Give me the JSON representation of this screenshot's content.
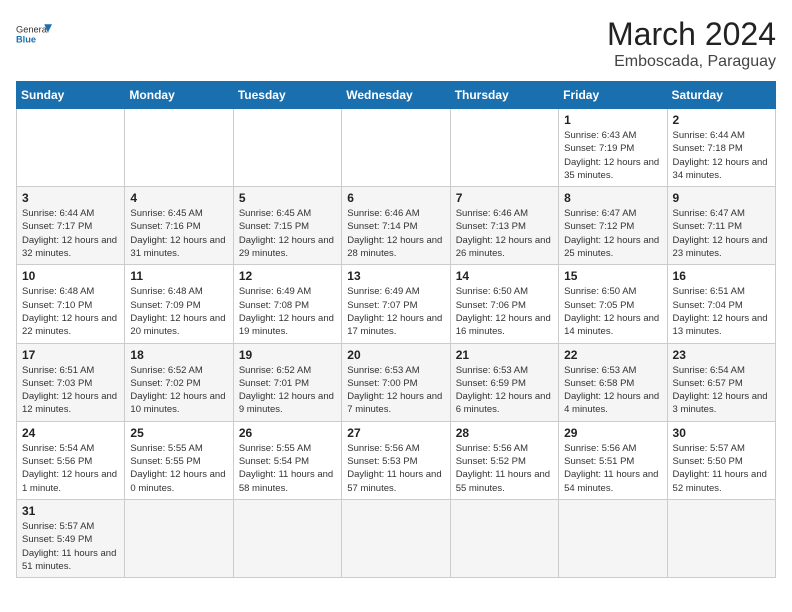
{
  "header": {
    "title": "March 2024",
    "subtitle": "Emboscada, Paraguay",
    "logo_general": "General",
    "logo_blue": "Blue"
  },
  "weekdays": [
    "Sunday",
    "Monday",
    "Tuesday",
    "Wednesday",
    "Thursday",
    "Friday",
    "Saturday"
  ],
  "weeks": [
    [
      {
        "day": "",
        "info": ""
      },
      {
        "day": "",
        "info": ""
      },
      {
        "day": "",
        "info": ""
      },
      {
        "day": "",
        "info": ""
      },
      {
        "day": "",
        "info": ""
      },
      {
        "day": "1",
        "info": "Sunrise: 6:43 AM\nSunset: 7:19 PM\nDaylight: 12 hours and 35 minutes."
      },
      {
        "day": "2",
        "info": "Sunrise: 6:44 AM\nSunset: 7:18 PM\nDaylight: 12 hours and 34 minutes."
      }
    ],
    [
      {
        "day": "3",
        "info": "Sunrise: 6:44 AM\nSunset: 7:17 PM\nDaylight: 12 hours and 32 minutes."
      },
      {
        "day": "4",
        "info": "Sunrise: 6:45 AM\nSunset: 7:16 PM\nDaylight: 12 hours and 31 minutes."
      },
      {
        "day": "5",
        "info": "Sunrise: 6:45 AM\nSunset: 7:15 PM\nDaylight: 12 hours and 29 minutes."
      },
      {
        "day": "6",
        "info": "Sunrise: 6:46 AM\nSunset: 7:14 PM\nDaylight: 12 hours and 28 minutes."
      },
      {
        "day": "7",
        "info": "Sunrise: 6:46 AM\nSunset: 7:13 PM\nDaylight: 12 hours and 26 minutes."
      },
      {
        "day": "8",
        "info": "Sunrise: 6:47 AM\nSunset: 7:12 PM\nDaylight: 12 hours and 25 minutes."
      },
      {
        "day": "9",
        "info": "Sunrise: 6:47 AM\nSunset: 7:11 PM\nDaylight: 12 hours and 23 minutes."
      }
    ],
    [
      {
        "day": "10",
        "info": "Sunrise: 6:48 AM\nSunset: 7:10 PM\nDaylight: 12 hours and 22 minutes."
      },
      {
        "day": "11",
        "info": "Sunrise: 6:48 AM\nSunset: 7:09 PM\nDaylight: 12 hours and 20 minutes."
      },
      {
        "day": "12",
        "info": "Sunrise: 6:49 AM\nSunset: 7:08 PM\nDaylight: 12 hours and 19 minutes."
      },
      {
        "day": "13",
        "info": "Sunrise: 6:49 AM\nSunset: 7:07 PM\nDaylight: 12 hours and 17 minutes."
      },
      {
        "day": "14",
        "info": "Sunrise: 6:50 AM\nSunset: 7:06 PM\nDaylight: 12 hours and 16 minutes."
      },
      {
        "day": "15",
        "info": "Sunrise: 6:50 AM\nSunset: 7:05 PM\nDaylight: 12 hours and 14 minutes."
      },
      {
        "day": "16",
        "info": "Sunrise: 6:51 AM\nSunset: 7:04 PM\nDaylight: 12 hours and 13 minutes."
      }
    ],
    [
      {
        "day": "17",
        "info": "Sunrise: 6:51 AM\nSunset: 7:03 PM\nDaylight: 12 hours and 12 minutes."
      },
      {
        "day": "18",
        "info": "Sunrise: 6:52 AM\nSunset: 7:02 PM\nDaylight: 12 hours and 10 minutes."
      },
      {
        "day": "19",
        "info": "Sunrise: 6:52 AM\nSunset: 7:01 PM\nDaylight: 12 hours and 9 minutes."
      },
      {
        "day": "20",
        "info": "Sunrise: 6:53 AM\nSunset: 7:00 PM\nDaylight: 12 hours and 7 minutes."
      },
      {
        "day": "21",
        "info": "Sunrise: 6:53 AM\nSunset: 6:59 PM\nDaylight: 12 hours and 6 minutes."
      },
      {
        "day": "22",
        "info": "Sunrise: 6:53 AM\nSunset: 6:58 PM\nDaylight: 12 hours and 4 minutes."
      },
      {
        "day": "23",
        "info": "Sunrise: 6:54 AM\nSunset: 6:57 PM\nDaylight: 12 hours and 3 minutes."
      }
    ],
    [
      {
        "day": "24",
        "info": "Sunrise: 5:54 AM\nSunset: 5:56 PM\nDaylight: 12 hours and 1 minute."
      },
      {
        "day": "25",
        "info": "Sunrise: 5:55 AM\nSunset: 5:55 PM\nDaylight: 12 hours and 0 minutes."
      },
      {
        "day": "26",
        "info": "Sunrise: 5:55 AM\nSunset: 5:54 PM\nDaylight: 11 hours and 58 minutes."
      },
      {
        "day": "27",
        "info": "Sunrise: 5:56 AM\nSunset: 5:53 PM\nDaylight: 11 hours and 57 minutes."
      },
      {
        "day": "28",
        "info": "Sunrise: 5:56 AM\nSunset: 5:52 PM\nDaylight: 11 hours and 55 minutes."
      },
      {
        "day": "29",
        "info": "Sunrise: 5:56 AM\nSunset: 5:51 PM\nDaylight: 11 hours and 54 minutes."
      },
      {
        "day": "30",
        "info": "Sunrise: 5:57 AM\nSunset: 5:50 PM\nDaylight: 11 hours and 52 minutes."
      }
    ],
    [
      {
        "day": "31",
        "info": "Sunrise: 5:57 AM\nSunset: 5:49 PM\nDaylight: 11 hours and 51 minutes."
      },
      {
        "day": "",
        "info": ""
      },
      {
        "day": "",
        "info": ""
      },
      {
        "day": "",
        "info": ""
      },
      {
        "day": "",
        "info": ""
      },
      {
        "day": "",
        "info": ""
      },
      {
        "day": "",
        "info": ""
      }
    ]
  ]
}
